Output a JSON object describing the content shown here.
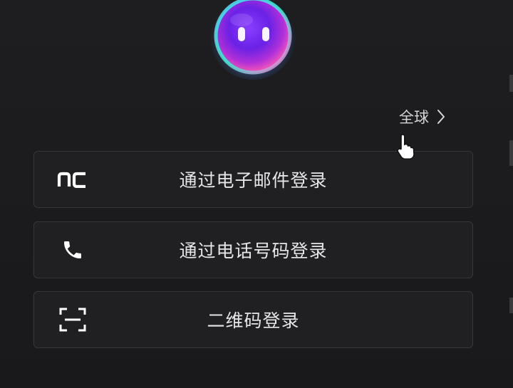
{
  "region": {
    "label": "全球",
    "icon": "chevron-right-icon"
  },
  "login_options": [
    {
      "label": "通过电子邮件登录",
      "icon": "nc-logo-icon"
    },
    {
      "label": "通过电话号码登录",
      "icon": "phone-icon"
    },
    {
      "label": "二维码登录",
      "icon": "qr-scan-icon"
    }
  ],
  "colors": {
    "background": "#1b1b1d",
    "button_background": "#202023",
    "button_border": "#37373b",
    "text": "#e6e6e8"
  }
}
